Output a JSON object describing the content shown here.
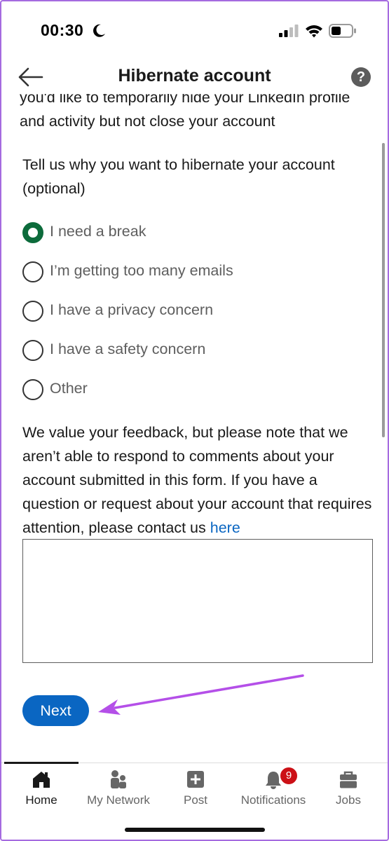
{
  "status_bar": {
    "time": "00:30"
  },
  "header": {
    "title": "Hibernate account",
    "help_symbol": "?"
  },
  "intro_text": "you'd like to temporarily hide your LinkedIn profile and activity but not close your account",
  "question": "Tell us why you want to hibernate your account (optional)",
  "reasons": [
    {
      "label": "I need a break",
      "selected": true
    },
    {
      "label": "I’m getting too many emails",
      "selected": false
    },
    {
      "label": "I have a privacy concern",
      "selected": false
    },
    {
      "label": "I have a safety concern",
      "selected": false
    },
    {
      "label": "Other",
      "selected": false
    }
  ],
  "feedback": {
    "text": "We value your feedback, but please note that we aren’t able to respond to comments about your account submitted in this form. If you have a question or request about your account that requires attention, please contact us",
    "link_label": "here"
  },
  "comment_box": {
    "value": ""
  },
  "next_button": {
    "label": "Next"
  },
  "tab_bar": {
    "tabs": [
      {
        "label": "Home",
        "icon": "home-icon",
        "active": true
      },
      {
        "label": "My Network",
        "icon": "network-icon",
        "active": false
      },
      {
        "label": "Post",
        "icon": "post-plus-icon",
        "active": false
      },
      {
        "label": "Notifications",
        "icon": "bell-icon",
        "active": false,
        "badge": "9"
      },
      {
        "label": "Jobs",
        "icon": "briefcase-icon",
        "active": false
      }
    ]
  },
  "colors": {
    "accent": "#0a66c2",
    "radio_selected": "#0c6b3b",
    "badge": "#cc1016",
    "annotation_arrow": "#b44fe8"
  }
}
